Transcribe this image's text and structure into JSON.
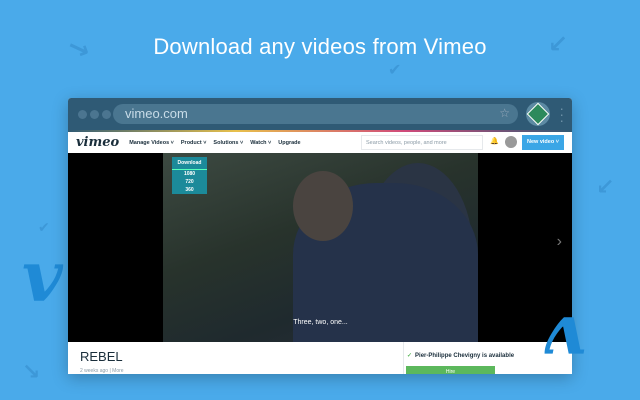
{
  "headline": "Download any videos from Vimeo",
  "browser": {
    "url": "vimeo.com",
    "star_icon": "☆",
    "extension": "video-downloader-extension"
  },
  "nav": {
    "logo": "vimeo",
    "items": [
      "Manage Videos ˅",
      "Product ˅",
      "Solutions ˅",
      "Watch ˅",
      "Upgrade"
    ],
    "search_placeholder": "Search videos, people, and more",
    "new_video": "New video ˅"
  },
  "download": {
    "label": "Download",
    "options": [
      "1080",
      "720",
      "360"
    ]
  },
  "video": {
    "subtitle": "Three, two, one..."
  },
  "details": {
    "title": "REBEL",
    "meta": "2 weeks ago  |  More",
    "availability": "Pier-Philippe Chevigny is available",
    "hire": "Hire"
  },
  "colors": {
    "background": "#4aaaea",
    "toolbar": "#2f5a75",
    "accent": "#3ba6e6",
    "download": "#1c8a9a",
    "hire": "#5cb85c"
  }
}
